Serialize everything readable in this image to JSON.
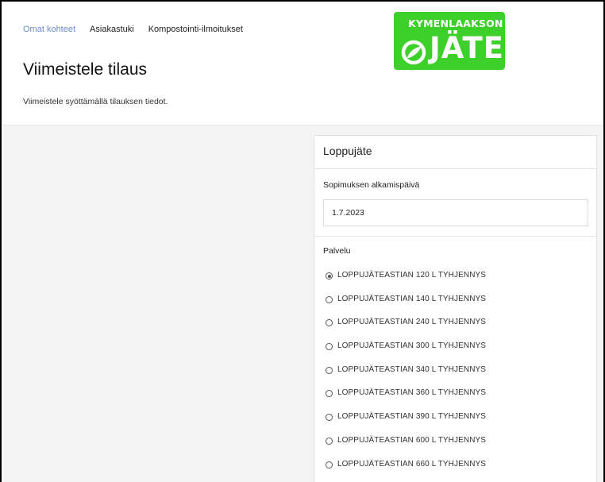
{
  "nav": {
    "items": [
      {
        "label": "Omat kohteet",
        "active": true
      },
      {
        "label": "Asiakastuki",
        "active": false
      },
      {
        "label": "Kompostointi-ilmoitukset",
        "active": false
      }
    ]
  },
  "logo": {
    "top_text": "KYMENLAAKSON",
    "word": "JÄTE",
    "color": "#3dd02a"
  },
  "page": {
    "title": "Viimeistele tilaus",
    "subtitle": "Viimeistele syöttämällä tilauksen tiedot."
  },
  "card": {
    "title": "Loppujäte",
    "start_date": {
      "label": "Sopimuksen alkamispäivä",
      "value": "1.7.2023"
    },
    "service": {
      "label": "Palvelu",
      "selected_index": 0,
      "options": [
        "LOPPUJÄTEASTIAN 120 L TYHJENNYS",
        "LOPPUJÄTEASTIAN 140 L TYHJENNYS",
        "LOPPUJÄTEASTIAN 240 L TYHJENNYS",
        "LOPPUJÄTEASTIAN 300 L TYHJENNYS",
        "LOPPUJÄTEASTIAN 340 L TYHJENNYS",
        "LOPPUJÄTEASTIAN 360 L TYHJENNYS",
        "LOPPUJÄTEASTIAN 390 L TYHJENNYS",
        "LOPPUJÄTEASTIAN 600 L TYHJENNYS",
        "LOPPUJÄTEASTIAN 660 L TYHJENNYS"
      ]
    }
  }
}
